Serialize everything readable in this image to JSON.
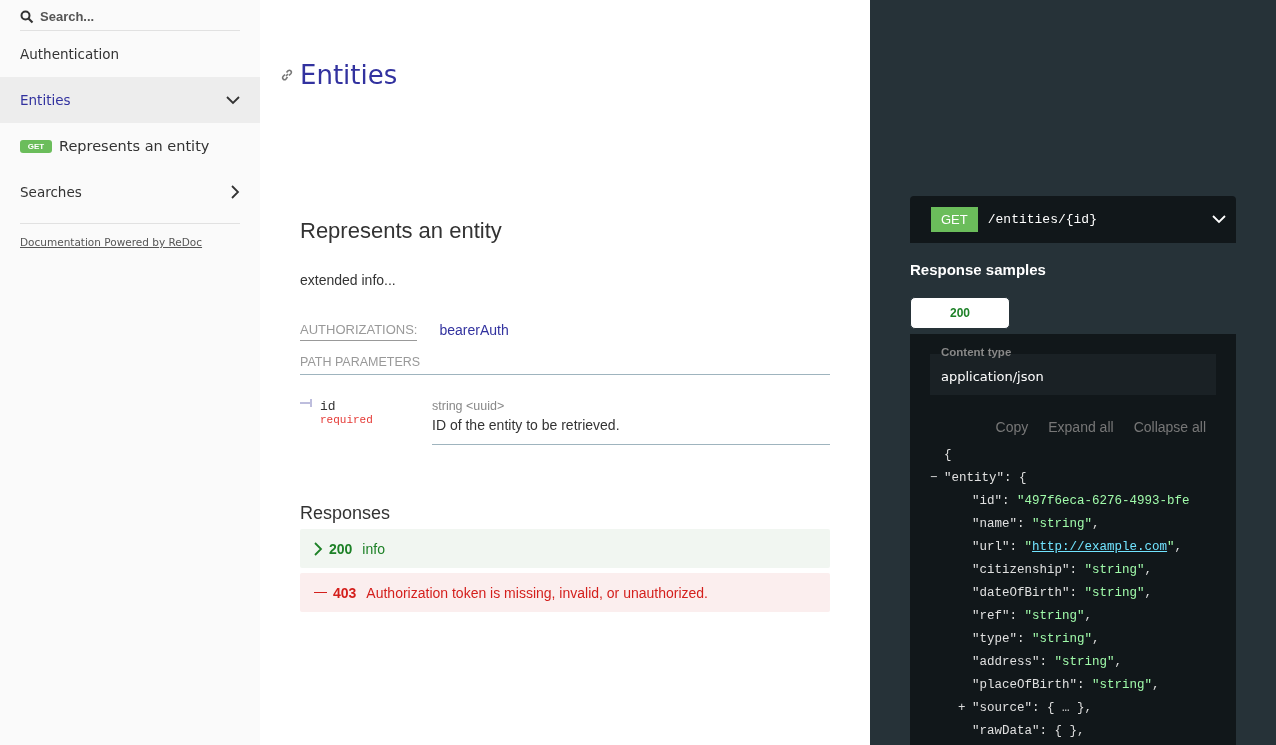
{
  "sidebar": {
    "search": {
      "placeholder": "Search..."
    },
    "items": [
      {
        "kind": "section",
        "label": "Authentication",
        "selected": false
      },
      {
        "kind": "group",
        "label": "Entities",
        "selected": true,
        "expanded": true
      },
      {
        "kind": "operation",
        "method": "GET",
        "label": "Represents an entity",
        "selected": false
      },
      {
        "kind": "group",
        "label": "Searches",
        "selected": false,
        "expanded": false
      }
    ],
    "footer": "Documentation Powered by ReDoc"
  },
  "content": {
    "section_title": "Entities",
    "operation": {
      "title": "Represents an entity",
      "description": "extended info...",
      "authorizations": {
        "label": "AUTHORIZATIONS:",
        "value": "bearerAuth"
      },
      "params_title": "PATH PARAMETERS",
      "params": [
        {
          "name": "id",
          "required": "required",
          "type": "string <uuid>",
          "description": "ID of the entity to be retrieved."
        }
      ],
      "responses_title": "Responses",
      "responses": [
        {
          "kind": "success",
          "code": "200",
          "text": "info",
          "expanded": false
        },
        {
          "kind": "error",
          "code": "403",
          "text": "Authorization token is missing, invalid, or unauthorized."
        }
      ]
    }
  },
  "panel": {
    "endpoint": {
      "method": "GET",
      "path": "/entities/{id}"
    },
    "samples_title": "Response samples",
    "tabs": [
      {
        "label": "200",
        "selected": true
      }
    ],
    "content_type": {
      "label": "Content type",
      "value": "application/json"
    },
    "actions": [
      "Copy",
      "Expand all",
      "Collapse all"
    ],
    "code": {
      "segments": [
        {
          "kind": "punct",
          "text": "{"
        }
      ],
      "children": [
        {
          "toggle": "−",
          "segments": [
            {
              "kind": "key",
              "text": "\"entity\""
            },
            {
              "kind": "punct",
              "text": ": {"
            }
          ],
          "children": [
            {
              "segments": [
                {
                  "kind": "key",
                  "text": "\"id\""
                },
                {
                  "kind": "punct",
                  "text": ": "
                },
                {
                  "kind": "string",
                  "text": "\"497f6eca-6276-4993-bfe"
                }
              ]
            },
            {
              "segments": [
                {
                  "kind": "key",
                  "text": "\"name\""
                },
                {
                  "kind": "punct",
                  "text": ": "
                },
                {
                  "kind": "string",
                  "text": "\"string\""
                },
                {
                  "kind": "punct",
                  "text": ","
                }
              ]
            },
            {
              "segments": [
                {
                  "kind": "key",
                  "text": "\"url\""
                },
                {
                  "kind": "punct",
                  "text": ": "
                },
                {
                  "kind": "string",
                  "text": "\""
                },
                {
                  "kind": "link",
                  "text": "http://example.com"
                },
                {
                  "kind": "string",
                  "text": "\""
                },
                {
                  "kind": "punct",
                  "text": ","
                }
              ]
            },
            {
              "segments": [
                {
                  "kind": "key",
                  "text": "\"citizenship\""
                },
                {
                  "kind": "punct",
                  "text": ": "
                },
                {
                  "kind": "string",
                  "text": "\"string\""
                },
                {
                  "kind": "punct",
                  "text": ","
                }
              ]
            },
            {
              "segments": [
                {
                  "kind": "key",
                  "text": "\"dateOfBirth\""
                },
                {
                  "kind": "punct",
                  "text": ": "
                },
                {
                  "kind": "string",
                  "text": "\"string\""
                },
                {
                  "kind": "punct",
                  "text": ","
                }
              ]
            },
            {
              "segments": [
                {
                  "kind": "key",
                  "text": "\"ref\""
                },
                {
                  "kind": "punct",
                  "text": ": "
                },
                {
                  "kind": "string",
                  "text": "\"string\""
                },
                {
                  "kind": "punct",
                  "text": ","
                }
              ]
            },
            {
              "segments": [
                {
                  "kind": "key",
                  "text": "\"type\""
                },
                {
                  "kind": "punct",
                  "text": ": "
                },
                {
                  "kind": "string",
                  "text": "\"string\""
                },
                {
                  "kind": "punct",
                  "text": ","
                }
              ]
            },
            {
              "segments": [
                {
                  "kind": "key",
                  "text": "\"address\""
                },
                {
                  "kind": "punct",
                  "text": ": "
                },
                {
                  "kind": "string",
                  "text": "\"string\""
                },
                {
                  "kind": "punct",
                  "text": ","
                }
              ]
            },
            {
              "segments": [
                {
                  "kind": "key",
                  "text": "\"placeOfBirth\""
                },
                {
                  "kind": "punct",
                  "text": ": "
                },
                {
                  "kind": "string",
                  "text": "\"string\""
                },
                {
                  "kind": "punct",
                  "text": ","
                }
              ]
            },
            {
              "toggle": "+",
              "segments": [
                {
                  "kind": "key",
                  "text": "\"source\""
                },
                {
                  "kind": "punct",
                  "text": ": { … },"
                }
              ]
            },
            {
              "segments": [
                {
                  "kind": "key",
                  "text": "\"rawData\""
                },
                {
                  "kind": "punct",
                  "text": ": { },"
                }
              ]
            }
          ]
        }
      ]
    }
  }
}
